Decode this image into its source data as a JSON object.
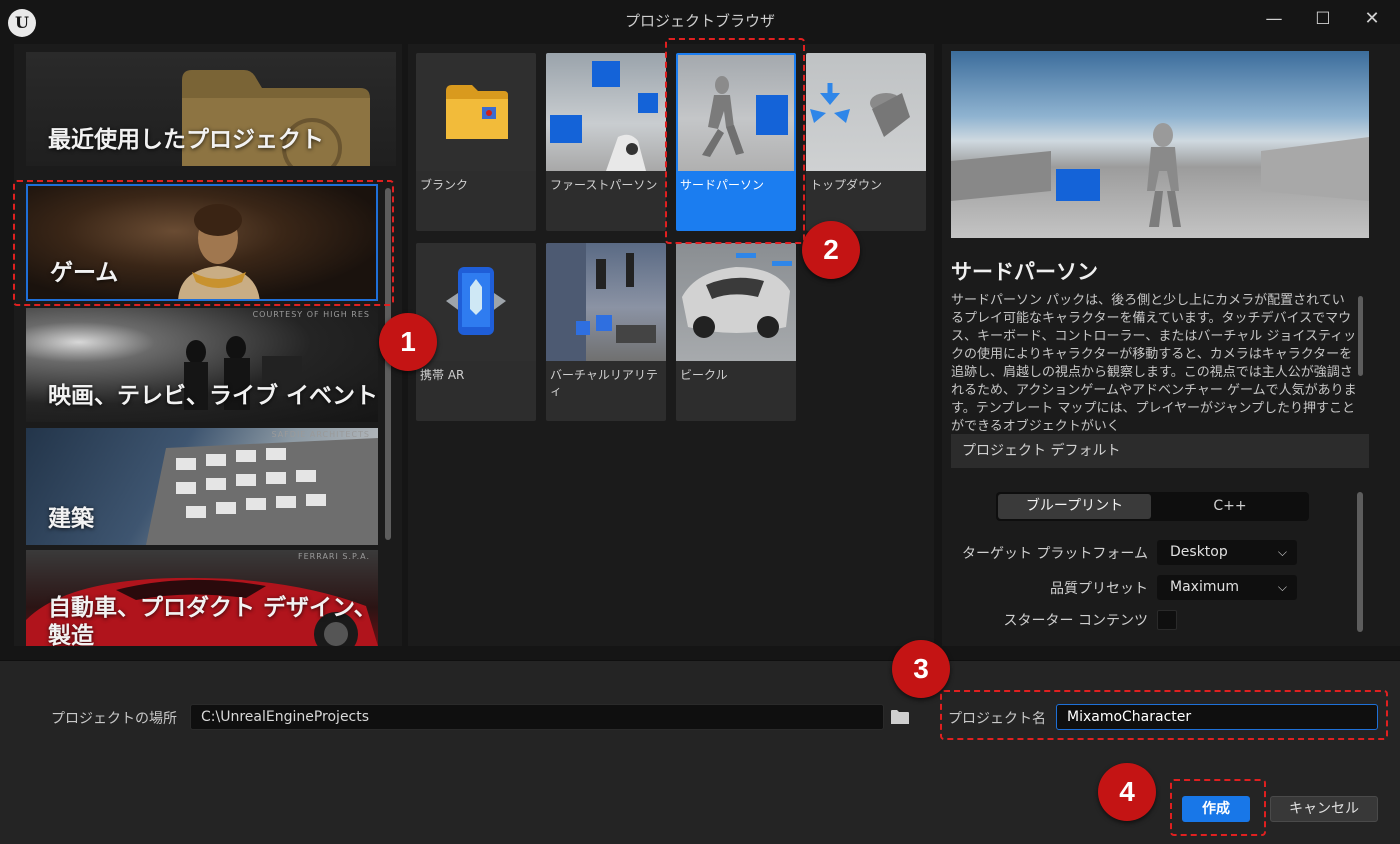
{
  "window": {
    "title": "プロジェクトブラウザ",
    "minimize": "—",
    "maximize": "☐",
    "close": "✕",
    "logo": "U"
  },
  "categories": {
    "recent": "最近使用したプロジェクト",
    "game": "ゲーム",
    "film": "映画、テレビ、ライブ イベント",
    "film_credit": "COURTESY OF HIGH RES",
    "arch": "建築",
    "arch_credit": "SAFDIE ARCHITECTS",
    "auto": "自動車、プロダクト デザイン、製造",
    "auto_credit": "FERRARI S.P.A."
  },
  "templates": {
    "blank": "ブランク",
    "first_person": "ファーストパーソン",
    "third_person": "サードパーソン",
    "top_down": "トップダウン",
    "handheld_ar": "携帯 AR",
    "virtual_reality": "バーチャルリアリティ",
    "vehicle": "ビークル",
    "selected": "サードパーソン"
  },
  "details": {
    "title": "サードパーソン",
    "description": "サードパーソン パックは、後ろ側と少し上にカメラが配置されているプレイ可能なキャラクターを備えています。タッチデバイスでマウス、キーボード、コントローラー、またはバーチャル ジョイスティックの使用によりキャラクターが移動すると、カメラはキャラクターを追跡し、肩越しの視点から観察します。この視点では主人公が強調されるため、アクションゲームやアドベンチャー ゲームで人気があります。テンプレート マップには、プレイヤーがジャンプしたり押すことができるオブジェクトがいく",
    "defaults_header": "プロジェクト デフォルト",
    "lang_blueprint": "ブループリント",
    "lang_cpp": "C++",
    "platform_label": "ターゲット プラットフォーム",
    "platform_value": "Desktop",
    "quality_label": "品質プリセット",
    "quality_value": "Maximum",
    "starter_label": "スターター コンテンツ",
    "starter_checked": false
  },
  "bottom": {
    "location_label": "プロジェクトの場所",
    "location_value": "C:\\UnrealEngineProjects",
    "name_label": "プロジェクト名",
    "name_value": "MixamoCharacter",
    "create": "作成",
    "cancel": "キャンセル"
  },
  "annotations": {
    "step1": "1",
    "step2": "2",
    "step3": "3",
    "step4": "4",
    "color": "#c41414"
  }
}
